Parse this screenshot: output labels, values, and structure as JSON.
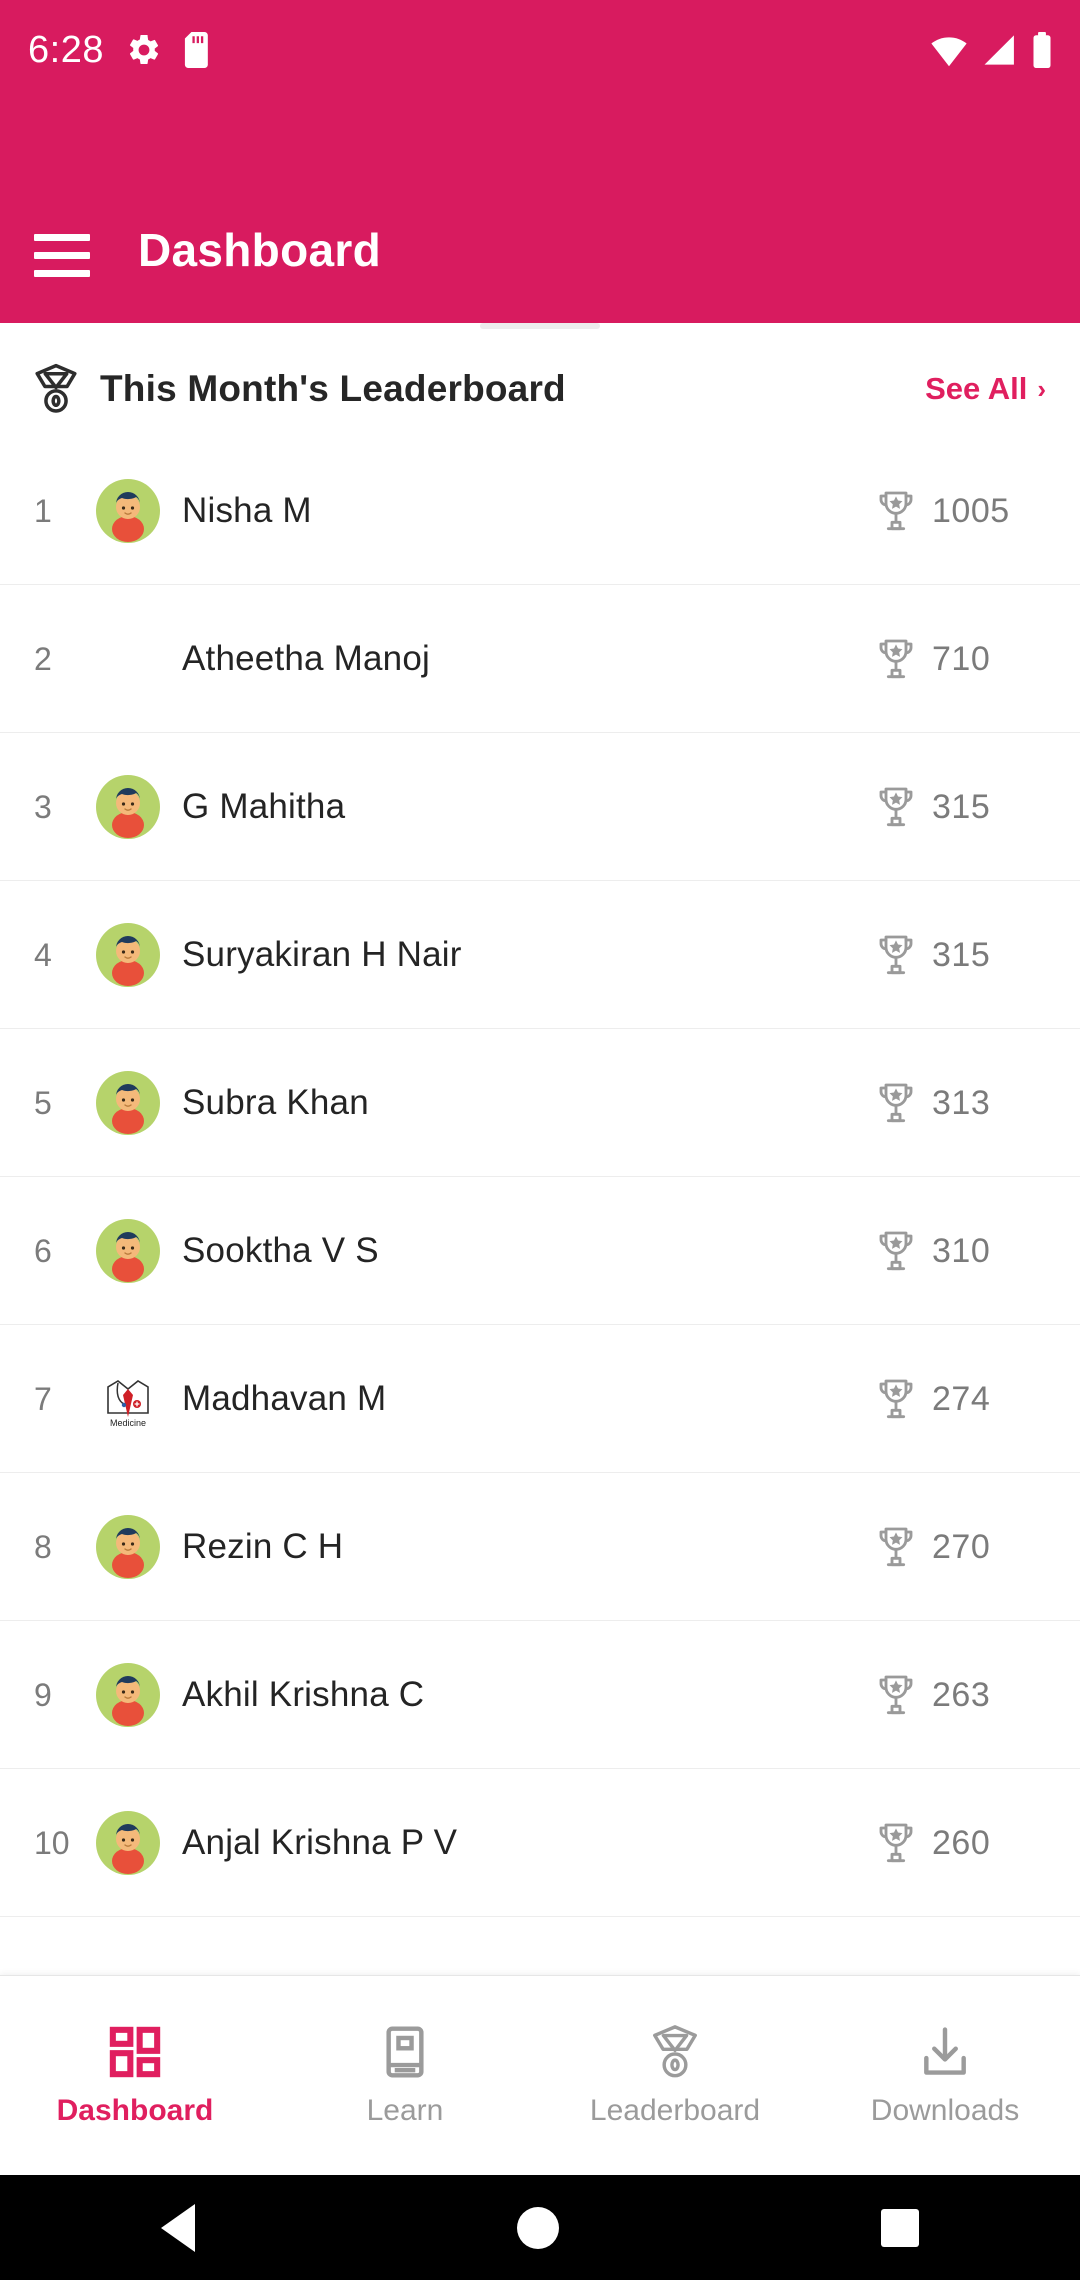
{
  "theme": {
    "primary": "#d81b5f",
    "accent": "#e01f5f",
    "avatar_bg": "#b6d36b",
    "muted": "#7b7b7b"
  },
  "status_bar": {
    "time": "6:28",
    "left_icons": [
      "gear-icon",
      "sdcard-icon"
    ],
    "right_icons": [
      "wifi-icon",
      "signal-icon",
      "battery-icon"
    ]
  },
  "app_bar": {
    "menu_icon": "hamburger-menu-icon",
    "title": "Dashboard"
  },
  "leaderboard": {
    "icon": "medal-icon",
    "title": "This Month's Leaderboard",
    "see_all_label": "See All",
    "see_all_chevron": "›",
    "score_icon": "trophy-icon",
    "rows": [
      {
        "rank": "1",
        "name": "Nisha M",
        "score": "1005",
        "avatar": "person-avatar"
      },
      {
        "rank": "2",
        "name": "Atheetha Manoj",
        "score": "710",
        "avatar": "none"
      },
      {
        "rank": "3",
        "name": "G Mahitha",
        "score": "315",
        "avatar": "person-avatar"
      },
      {
        "rank": "4",
        "name": "Suryakiran H Nair",
        "score": "315",
        "avatar": "person-avatar"
      },
      {
        "rank": "5",
        "name": "Subra Khan",
        "score": "313",
        "avatar": "person-avatar"
      },
      {
        "rank": "6",
        "name": "Sooktha V S",
        "score": "310",
        "avatar": "person-avatar"
      },
      {
        "rank": "7",
        "name": "Madhavan M",
        "score": "274",
        "avatar": "medicine-logo-avatar"
      },
      {
        "rank": "8",
        "name": "Rezin C H",
        "score": "270",
        "avatar": "person-avatar"
      },
      {
        "rank": "9",
        "name": "Akhil Krishna C",
        "score": "263",
        "avatar": "person-avatar"
      },
      {
        "rank": "10",
        "name": "Anjal Krishna P V",
        "score": "260",
        "avatar": "person-avatar"
      }
    ]
  },
  "bottom_nav": {
    "items": [
      {
        "label": "Dashboard",
        "icon": "grid-icon",
        "active": true
      },
      {
        "label": "Learn",
        "icon": "book-icon",
        "active": false
      },
      {
        "label": "Leaderboard",
        "icon": "medal-icon",
        "active": false
      },
      {
        "label": "Downloads",
        "icon": "download-icon",
        "active": false
      }
    ]
  },
  "system_nav": {
    "back": "back-triangle-icon",
    "home": "home-circle-icon",
    "recents": "recents-square-icon"
  }
}
